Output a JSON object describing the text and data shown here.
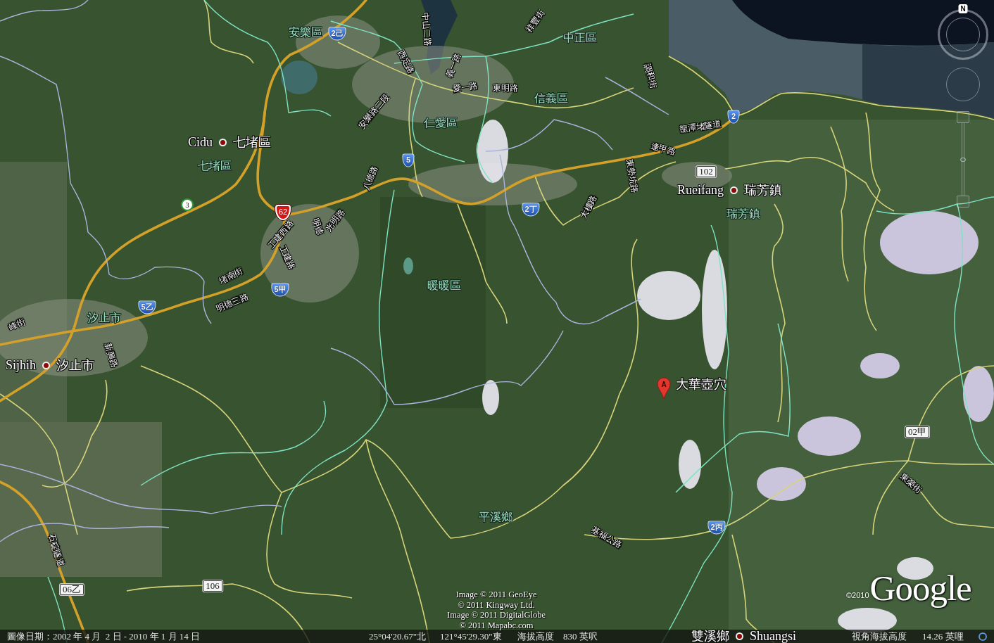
{
  "map": {
    "towns": [
      {
        "left": "Cidu",
        "right": "七堵區"
      },
      {
        "left": "Rueifang",
        "right": "瑞芳鎮"
      },
      {
        "left": "Sijhih",
        "right": "汐止市"
      },
      {
        "left": "雙溪鄉",
        "right": "Shuangsi"
      }
    ],
    "districts": [
      "安樂區",
      "中正區",
      "信義區",
      "仁愛區",
      "七堵區",
      "瑞芳鎮",
      "暖暖區",
      "汐止市",
      "平溪鄉"
    ],
    "roads": [
      "祥豐街",
      "中山二路",
      "西定路",
      "義一路",
      "愛一路",
      "東明路",
      "安樂路二段",
      "調和街",
      "龍潭堵隧道",
      "逢甲路",
      "八德路",
      "東勢坑路",
      "大樓路",
      "工建西路",
      "工建路",
      "明德",
      "光明路",
      "堵南街",
      "明德三路",
      "新興路",
      "峰街",
      "石碇隧道",
      "基福公路",
      "東榮街"
    ],
    "route_signs": [
      {
        "kind": "provincial",
        "label": "2己"
      },
      {
        "kind": "provincial",
        "label": "5"
      },
      {
        "kind": "provincial",
        "label": "2丁"
      },
      {
        "kind": "provincial",
        "label": "2"
      },
      {
        "kind": "provincial",
        "label": "5甲"
      },
      {
        "kind": "provincial",
        "label": "5乙"
      },
      {
        "kind": "provincial",
        "label": "2丙"
      },
      {
        "kind": "freeway",
        "label": "3"
      },
      {
        "kind": "expressway",
        "label": "62"
      },
      {
        "kind": "county",
        "label": "102"
      },
      {
        "kind": "county",
        "label": "02甲"
      },
      {
        "kind": "county",
        "label": "106"
      },
      {
        "kind": "county",
        "label": "06乙"
      }
    ],
    "placemark": {
      "letter": "A",
      "label": "大華壺穴"
    }
  },
  "navigation": {
    "compass_letter": "N",
    "zoom_slider": {
      "level": 0.5
    }
  },
  "attribution": {
    "credits": [
      "Image © 2011 GeoEye",
      "© 2011 Kingway Ltd.",
      "Image © 2011 DigitalGlobe",
      "© 2011 Mapabc.com"
    ],
    "copyright": "©2010",
    "logo": "Google"
  },
  "status_bar": {
    "imagery_date": "圖像日期：2002 年 4 月  2 日 - 2010 年 1 月 14 日",
    "latitude": "25°04'20.67\"北",
    "longitude": "121°45'29.30\"東",
    "elevation_label": "海拔高度",
    "elevation": "830 英呎",
    "eye_altitude_label": "視角海拔高度",
    "eye_altitude": "14.26 英哩"
  }
}
